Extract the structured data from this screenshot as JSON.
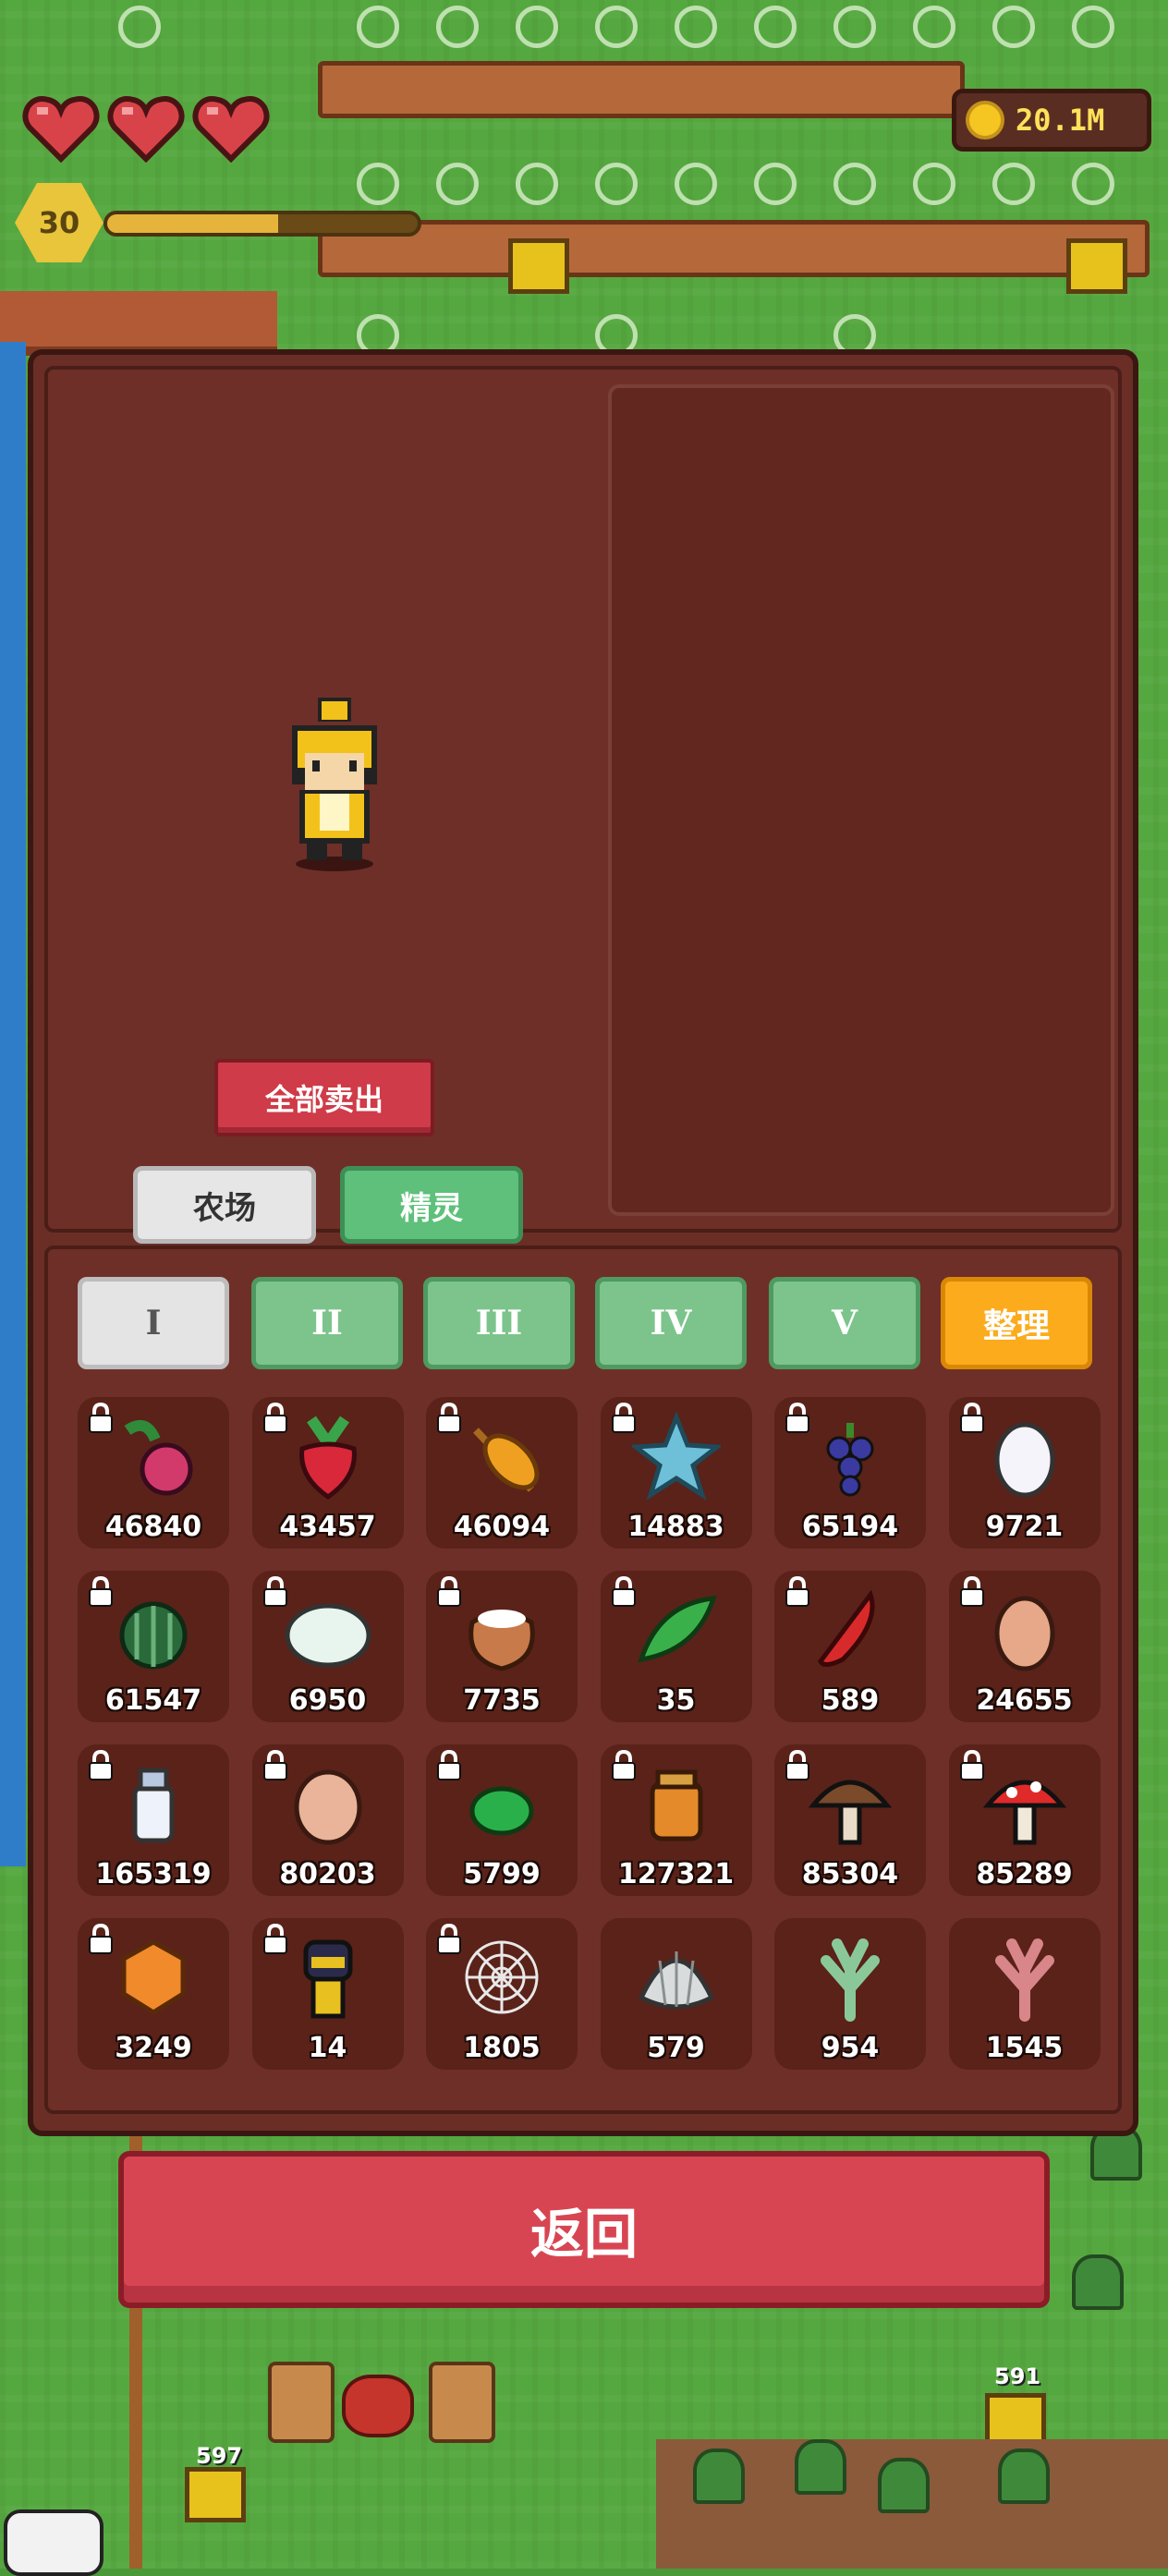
{
  "hud": {
    "hearts": 3,
    "level": "30",
    "xp_progress": 0.55,
    "coins": "20.1M"
  },
  "panel": {
    "sell_all_label": "全部卖出",
    "mode_farm_label": "农场",
    "mode_spirit_label": "精灵",
    "tabs": [
      {
        "label": "I",
        "state": "active"
      },
      {
        "label": "II",
        "state": "inactive"
      },
      {
        "label": "III",
        "state": "inactive"
      },
      {
        "label": "IV",
        "state": "inactive"
      },
      {
        "label": "V",
        "state": "inactive"
      }
    ],
    "sort_label": "整理",
    "items": [
      {
        "icon": "radish-icon",
        "count": "46840",
        "locked": true
      },
      {
        "icon": "beet-icon",
        "count": "43457",
        "locked": true
      },
      {
        "icon": "wheat-icon",
        "count": "46094",
        "locked": true
      },
      {
        "icon": "starfruit-icon",
        "count": "14883",
        "locked": true
      },
      {
        "icon": "grapes-icon",
        "count": "65194",
        "locked": true
      },
      {
        "icon": "white-egg-icon",
        "count": "9721",
        "locked": true
      },
      {
        "icon": "watermelon-icon",
        "count": "61547",
        "locked": true
      },
      {
        "icon": "wool-icon",
        "count": "6950",
        "locked": true
      },
      {
        "icon": "flour-sack-icon",
        "count": "7735",
        "locked": true
      },
      {
        "icon": "leaf-icon",
        "count": "35",
        "locked": true
      },
      {
        "icon": "chili-pepper-icon",
        "count": "589",
        "locked": true
      },
      {
        "icon": "brown-egg-icon",
        "count": "24655",
        "locked": true
      },
      {
        "icon": "milk-bottle-icon",
        "count": "165319",
        "locked": true
      },
      {
        "icon": "large-egg-icon",
        "count": "80203",
        "locked": true
      },
      {
        "icon": "green-slime-icon",
        "count": "5799",
        "locked": true
      },
      {
        "icon": "honey-jar-icon",
        "count": "127321",
        "locked": true
      },
      {
        "icon": "brown-mushroom-icon",
        "count": "85304",
        "locked": true
      },
      {
        "icon": "red-mushroom-icon",
        "count": "85289",
        "locked": true
      },
      {
        "icon": "honeycomb-icon",
        "count": "3249",
        "locked": true
      },
      {
        "icon": "bee-knight-icon",
        "count": "14",
        "locked": true
      },
      {
        "icon": "spider-web-icon",
        "count": "1805",
        "locked": true
      },
      {
        "icon": "shell-icon",
        "count": "579",
        "locked": false
      },
      {
        "icon": "green-coral-icon",
        "count": "954",
        "locked": false
      },
      {
        "icon": "pink-coral-icon",
        "count": "1545",
        "locked": false
      }
    ]
  },
  "back_label": "返回",
  "world": {
    "hive_label_left": "597",
    "hive_label_right": "591"
  },
  "colors": {
    "panel": "#6a2e26",
    "tab_active": "#e4e4e4",
    "tab_inactive": "#7cc48b",
    "sort_button": "#fbab1c",
    "sell_button": "#cf3b48",
    "back_button": "#d84552",
    "coin_text": "#ffe15a"
  }
}
